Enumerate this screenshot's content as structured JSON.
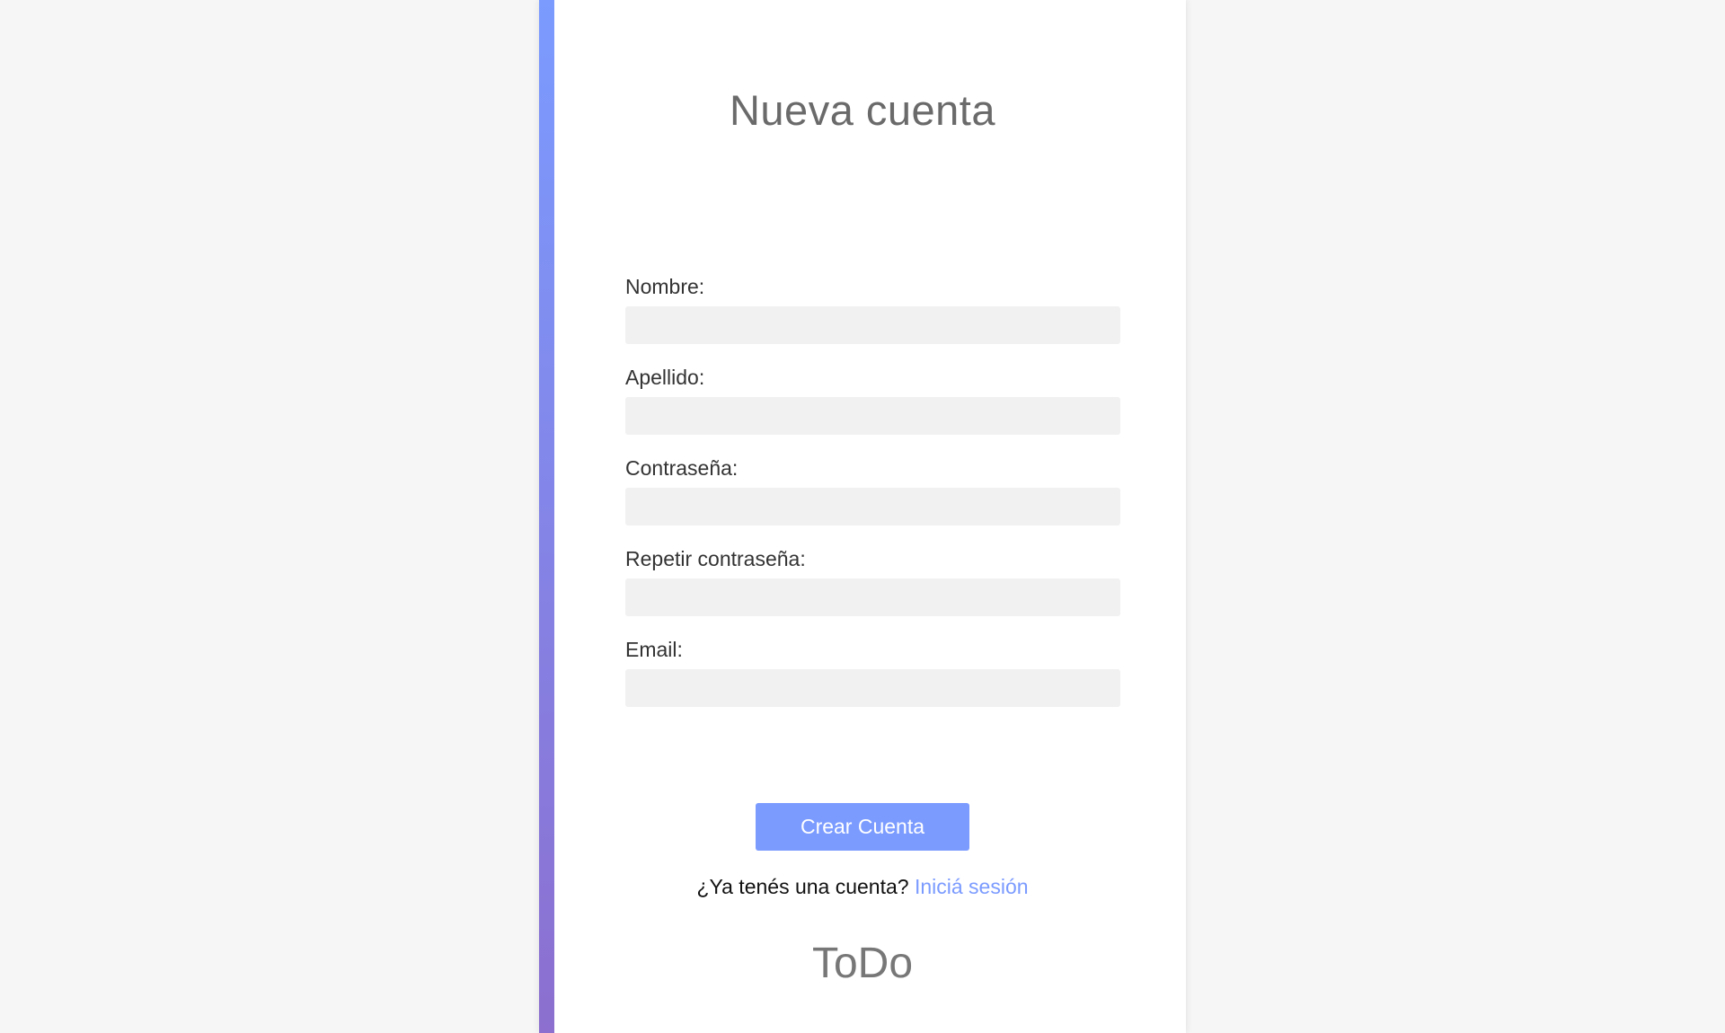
{
  "page": {
    "title": "Nueva cuenta",
    "brand": "ToDo"
  },
  "form": {
    "fields": [
      {
        "label": "Nombre:",
        "value": "",
        "placeholder": ""
      },
      {
        "label": "Apellido:",
        "value": "",
        "placeholder": ""
      },
      {
        "label": "Contraseña:",
        "value": "",
        "placeholder": ""
      },
      {
        "label": "Repetir contraseña:",
        "value": "",
        "placeholder": ""
      },
      {
        "label": "Email:",
        "value": "",
        "placeholder": ""
      }
    ],
    "submit_label": "Crear Cuenta"
  },
  "login": {
    "prompt": "¿Ya tenés una cuenta?",
    "link_label": "Iniciá sesión"
  },
  "colors": {
    "accent": "#7b9bff",
    "accent_gradient_end": "#8c6fcf",
    "background": "#f6f6f6",
    "card": "#ffffff",
    "input_bg": "#f1f1f1"
  }
}
